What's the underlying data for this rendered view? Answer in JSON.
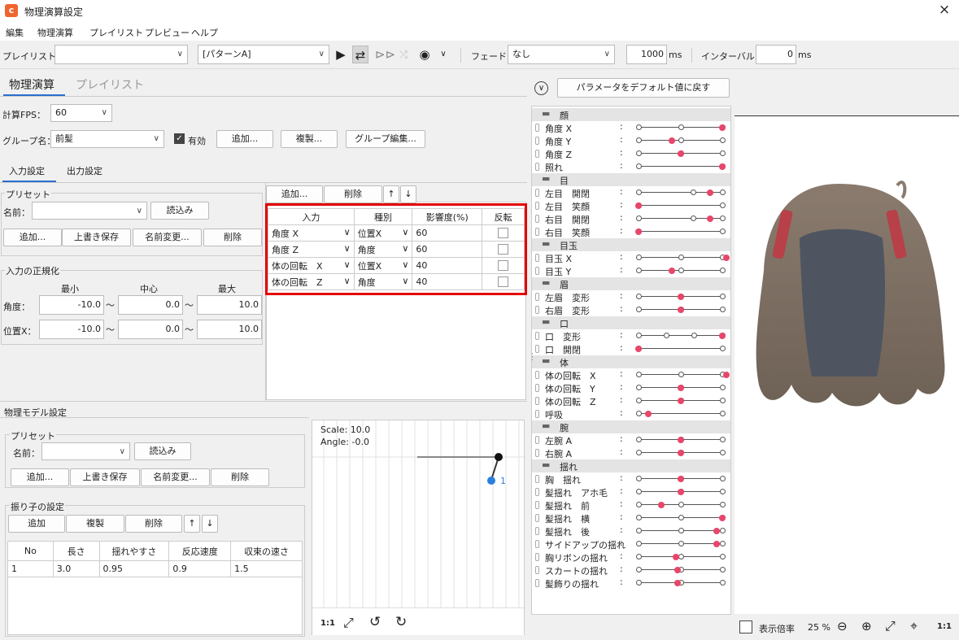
{
  "window": {
    "title": "物理演算設定",
    "close_icon": "×"
  },
  "menu": [
    "編集",
    "物理演算",
    "プレイリスト",
    "プレビュー",
    "ヘルプ"
  ],
  "toolbar": {
    "playlist_label": "プレイリスト：",
    "playlist_value": "",
    "pattern_value": "[パターンA]",
    "fade_label": "フェード：",
    "fade_value": "なし",
    "duration_value": "1000",
    "duration_unit": "ms",
    "interval_label": "インターバル：",
    "interval_value": "0",
    "interval_unit": "ms"
  },
  "tabs": {
    "main": [
      "物理演算",
      "プレイリスト"
    ],
    "sub": [
      "入力設定",
      "出力設定"
    ]
  },
  "settings": {
    "fps_label": "計算FPS：",
    "fps_value": "60",
    "group_label": "グループ名：",
    "group_value": "前髪",
    "enabled_label": "有効",
    "add_btn": "追加...",
    "copy_btn": "複製...",
    "edit_btn": "グループ編集..."
  },
  "preset": {
    "title": "プリセット",
    "name_label": "名前：",
    "name_value": "",
    "load_btn": "読込み",
    "add_btn": "追加...",
    "overwrite_btn": "上書き保存",
    "rename_btn": "名前変更...",
    "delete_btn": "削除"
  },
  "input_table": {
    "add_btn": "追加...",
    "delete_btn": "削除",
    "up": "↑",
    "down": "↓",
    "headers": [
      "入力",
      "種別",
      "影響度(%)",
      "反転"
    ],
    "rows": [
      {
        "input": "角度 X",
        "type": "位置X",
        "weight": "60"
      },
      {
        "input": "角度 Z",
        "type": "角度",
        "weight": "60"
      },
      {
        "input": "体の回転　X",
        "type": "位置X",
        "weight": "40"
      },
      {
        "input": "体の回転　Z",
        "type": "角度",
        "weight": "40"
      }
    ]
  },
  "normalize": {
    "title": "入力の正規化",
    "min_label": "最小",
    "mid_label": "中心",
    "max_label": "最大",
    "tilde": "〜",
    "rows": [
      {
        "label": "角度：",
        "min": "-10.0",
        "mid": "0.0",
        "max": "10.0"
      },
      {
        "label": "位置X：",
        "min": "-10.0",
        "mid": "0.0",
        "max": "10.0"
      }
    ]
  },
  "model": {
    "title": "物理モデル設定",
    "preset_title": "プリセット",
    "name_label": "名前：",
    "load_btn": "読込み",
    "add_btn": "追加...",
    "overwrite_btn": "上書き保存",
    "rename_btn": "名前変更...",
    "delete_btn": "削除",
    "pendulum_title": "振り子の設定",
    "p_add": "追加",
    "p_copy": "複製",
    "p_delete": "削除",
    "p_up": "↑",
    "p_down": "↓",
    "headers": [
      "No",
      "長さ",
      "揺れやすさ",
      "反応速度",
      "収束の速さ"
    ],
    "rows": [
      [
        "1",
        "3.0",
        "0.95",
        "0.9",
        "1.5"
      ]
    ]
  },
  "graph": {
    "scale_text": "Scale: 10.0",
    "angle_text": "Angle: -0.0",
    "node_label": "1",
    "zoom_11": "1:1"
  },
  "param_header": {
    "reset_btn": "パラメータをデフォルト値に戻す"
  },
  "params": [
    {
      "g": "顔"
    },
    {
      "n": "角度 X",
      "d": 1.0,
      "t": [
        0,
        0.5,
        1
      ]
    },
    {
      "n": "角度 Y",
      "d": 0.4,
      "t": [
        0,
        0.5,
        1
      ]
    },
    {
      "n": "角度 Z",
      "d": 0.5,
      "t": [
        0,
        0.5,
        1
      ]
    },
    {
      "n": "照れ",
      "d": 1.0,
      "t": [
        0,
        1
      ]
    },
    {
      "g": "目"
    },
    {
      "n": "左目　開閉",
      "d": 0.85,
      "t": [
        0,
        0.65,
        1
      ]
    },
    {
      "n": "左目　笑顔",
      "d": 0.0,
      "t": [
        0,
        1
      ]
    },
    {
      "n": "右目　開閉",
      "d": 0.85,
      "t": [
        0,
        0.65,
        1
      ]
    },
    {
      "n": "右目　笑顔",
      "d": 0.0,
      "t": [
        0,
        1
      ]
    },
    {
      "g": "目玉"
    },
    {
      "n": "目玉 X",
      "d": 1.05,
      "t": [
        0,
        0.5,
        1
      ]
    },
    {
      "n": "目玉 Y",
      "d": 0.4,
      "t": [
        0,
        0.5,
        1
      ]
    },
    {
      "g": "眉"
    },
    {
      "n": "左眉　変形",
      "d": 0.5,
      "t": [
        0,
        0.5,
        1
      ]
    },
    {
      "n": "右眉　変形",
      "d": 0.5,
      "t": [
        0,
        0.5,
        1
      ]
    },
    {
      "g": "口"
    },
    {
      "n": "口　変形",
      "d": 1.0,
      "t": [
        0,
        0.33,
        0.66,
        1
      ]
    },
    {
      "n": "口　開閉",
      "d": 0.0,
      "t": [
        0,
        1
      ]
    },
    {
      "g": "体"
    },
    {
      "n": "体の回転　X",
      "d": 1.05,
      "t": [
        0,
        0.5,
        1
      ]
    },
    {
      "n": "体の回転　Y",
      "d": 0.5,
      "t": [
        0,
        0.5,
        1
      ]
    },
    {
      "n": "体の回転　Z",
      "d": 0.5,
      "t": [
        0,
        0.5,
        1
      ]
    },
    {
      "n": "呼吸",
      "d": 0.12,
      "t": [
        0,
        1
      ]
    },
    {
      "g": "腕"
    },
    {
      "n": "左腕 A",
      "d": 0.5,
      "t": [
        0,
        0.5,
        1
      ]
    },
    {
      "n": "右腕 A",
      "d": 0.5,
      "t": [
        0,
        0.5,
        1
      ]
    },
    {
      "g": "揺れ"
    },
    {
      "n": "胸　揺れ",
      "d": 0.5,
      "t": [
        0,
        0.5,
        1
      ]
    },
    {
      "n": "髪揺れ　アホ毛",
      "d": 0.5,
      "t": [
        0,
        0.5,
        1
      ]
    },
    {
      "n": "髪揺れ　前",
      "d": 0.27,
      "t": [
        0,
        0.5,
        1
      ]
    },
    {
      "n": "髪揺れ　横",
      "d": 1.0,
      "t": [
        0,
        0.5,
        1
      ]
    },
    {
      "n": "髪揺れ　後",
      "d": 0.93,
      "t": [
        0,
        0.5,
        1
      ]
    },
    {
      "n": "サイドアップの揺れ",
      "d": 0.93,
      "t": [
        0,
        0.5,
        1
      ]
    },
    {
      "n": "胸リボンの揺れ",
      "d": 0.45,
      "t": [
        0,
        0.5,
        1
      ]
    },
    {
      "n": "スカートの揺れ",
      "d": 0.47,
      "t": [
        0,
        0.5,
        1
      ]
    },
    {
      "n": "髪飾りの揺れ",
      "d": 0.47,
      "t": [
        0,
        0.5,
        1
      ]
    }
  ],
  "viewer": {
    "zoom_label": "表示倍率",
    "zoom_value": "25 %",
    "zoom_11": "1:1"
  },
  "colors": {
    "accent": "#e8466a",
    "red_box": "#e40000",
    "logo": "#f0642f"
  }
}
